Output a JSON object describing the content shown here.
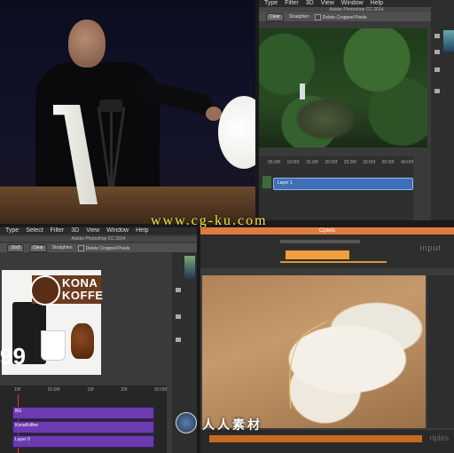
{
  "q2": {
    "menu": [
      "Type",
      "Filter",
      "3D",
      "View",
      "Window",
      "Help"
    ],
    "app_title": "Adobe Photoshop CC 2014",
    "options": {
      "clear": "Clear",
      "straighten": "Straighten",
      "delete_cropped": "Delete Cropped Pixels"
    },
    "ruler": [
      "05:00f",
      "10:00f",
      "15:00f",
      "20:00f",
      "25:00f",
      "30:00f",
      "35:00f",
      "40:00f"
    ],
    "layer": "Layer 1"
  },
  "q3": {
    "menu": [
      "Type",
      "Select",
      "Filter",
      "3D",
      "View",
      "Window",
      "Help"
    ],
    "app_title": "Adobe Photoshop CC 2014",
    "options": {
      "ratio": "16x9",
      "clear": "Clear",
      "straighten": "Straighten",
      "delete_cropped": "Delete Cropped Pixels"
    },
    "brand": "KONA\nKOFFE",
    "price": "99",
    "ruler": [
      "10f",
      "01:00f",
      "10f",
      "20f",
      "02:00f"
    ],
    "tracks": [
      "BG",
      "KonaKoffee",
      "Layer 0"
    ]
  },
  "q4": {
    "title": "Ciplets",
    "input_label": "input",
    "bottom_label": "riples"
  },
  "watermark": {
    "url": "www.cg-ku.com",
    "site": "人人素材"
  }
}
